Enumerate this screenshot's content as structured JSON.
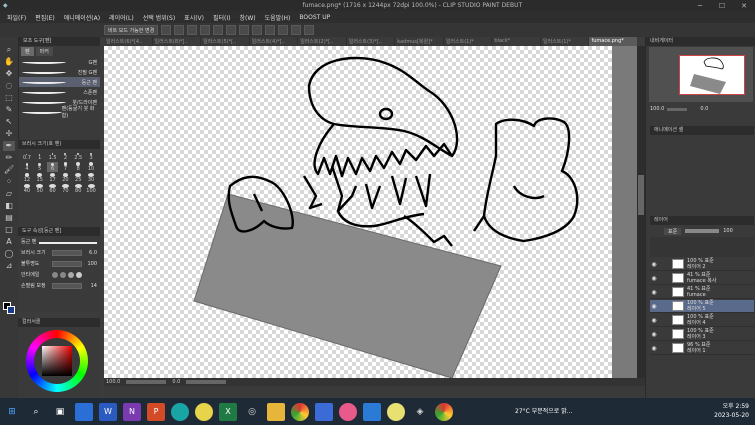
{
  "title": "fumace.png* (1716 x 1244px 72dpi 100.0%) - CLIP STUDIO PAINT DEBUT",
  "menu": [
    "파일(F)",
    "편집(E)",
    "애니메이션(A)",
    "레이어(L)",
    "선택 범위(S)",
    "표시(V)",
    "필터(I)",
    "창(W)",
    "도움말(H)",
    "BOOST UP"
  ],
  "cmd": {
    "mode_label": "비트 모드 가능한 변경"
  },
  "tabs": [
    "일러스트(6)*[4..",
    "일러스트(8)*[..",
    "일러스트(5)*[..",
    "일러스트(4)*[..",
    "일러스트(2)*[..",
    "일러스트(3)*[..",
    "kadmus[복원]*",
    "일러스트(1)*",
    "black*",
    "일러스트(1)*",
    "fumace.png*"
  ],
  "subtool": {
    "header": "보조 도구[펜]",
    "tab1": "펜",
    "tab2": "마커",
    "brushes": [
      "G펜",
      "진필 G펜",
      "둥근 펜",
      "스푼펜",
      "붓/드라이펜",
      "펜(등굴기 붓 화합)"
    ]
  },
  "brushsize": {
    "header": "브러시 크기(호 펜)",
    "sizes": [
      "0.7",
      "1",
      "1.5",
      "2",
      "2.5",
      "3",
      "4",
      "5",
      "6",
      "7",
      "8",
      "10",
      "12",
      "15",
      "17",
      "20",
      "25",
      "30",
      "40",
      "50",
      "60",
      "70",
      "80",
      "100"
    ]
  },
  "toolprop": {
    "header": "도구 속성[둥근 펜]",
    "name": "둥근 펜",
    "rows": [
      {
        "label": "브러시 크기",
        "value": "6.0"
      },
      {
        "label": "불투명도",
        "value": "100"
      },
      {
        "label": "안티에일",
        "value": ""
      },
      {
        "label": "손떨림 보정",
        "value": "14"
      }
    ]
  },
  "color": {
    "header": "컬러서클"
  },
  "status": {
    "zoom": "100.0",
    "angle": "0.0"
  },
  "navigator": {
    "header": "내비게이터",
    "zoom": "100.0",
    "angle": "0.0"
  },
  "animation": {
    "header": "애니메이션 셀"
  },
  "layers": {
    "header": "레이어",
    "blend": "표준",
    "opacity": "100",
    "rows": [
      {
        "a": "100 % 표준",
        "b": "레이어 2"
      },
      {
        "a": "41 % 표준",
        "b": "fumace 복사"
      },
      {
        "a": "41 % 표준",
        "b": "fumace"
      },
      {
        "a": "100 % 표준",
        "b": "레이어 5"
      },
      {
        "a": "100 % 표준",
        "b": "레이어 4"
      },
      {
        "a": "100 % 표준",
        "b": "레이어 3"
      },
      {
        "a": "96 % 표준",
        "b": "레이어 1"
      }
    ]
  },
  "taskbar": {
    "weather": "27°C 부분적으로 맑...",
    "time": "오후 2:59",
    "date": "2023-05-20"
  },
  "colors": {
    "accent": "#5a6a8a",
    "shape": "#8a8a8a"
  }
}
